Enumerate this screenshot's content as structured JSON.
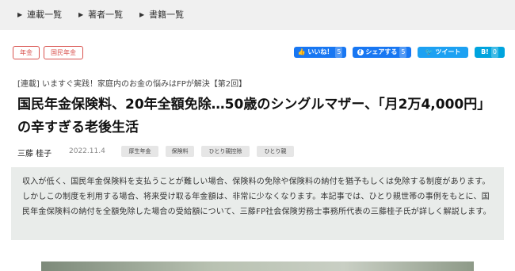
{
  "nav": {
    "items": [
      {
        "label": "連載一覧"
      },
      {
        "label": "著者一覧"
      },
      {
        "label": "書籍一覧"
      }
    ]
  },
  "tags": [
    "年金",
    "国民年金"
  ],
  "share": {
    "like": {
      "label": "いいね！",
      "count": "5",
      "icon": "thumbs-up-icon",
      "color": "#1877f2"
    },
    "facebook": {
      "label": "シェアする",
      "count": "5",
      "icon": "facebook-icon",
      "color": "#1877f2"
    },
    "tweet": {
      "label": "ツイート",
      "icon": "twitter-bird-icon",
      "color": "#1da1f2"
    },
    "hatena": {
      "label": "B!",
      "count": "0",
      "color": "#00a4de"
    }
  },
  "article": {
    "series": "[連載] いますぐ実践！家庭内のお金の悩みはFPが解決【第2回】",
    "title": "国民年金保険料、20年全額免除…50歳のシングルマザー、「月2万4,000円」の辛すぎる老後生活",
    "author": "三藤 桂子",
    "date": "2022.11.4",
    "keywords": [
      "厚生年金",
      "保険料",
      "ひとり親控除",
      "ひとり親"
    ],
    "summary": "収入が低く、国民年金保険料を支払うことが難しい場合、保険料の免除や保険料の納付を猶予もしくは免除する制度があります。しかしこの制度を利用する場合、将来受け取る年金額は、非常に少なくなります。本記事では、ひとり親世帯の事例をもとに、国民年金保険料の納付を全額免除した場合の受給額について、三藤FP社会保険労務士事務所代表の三藤桂子氏が詳しく解説します。"
  },
  "colors": {
    "tag": "#d9534f",
    "summary_bg": "#e9ecea",
    "nav_bg": "#f0f0f0"
  }
}
